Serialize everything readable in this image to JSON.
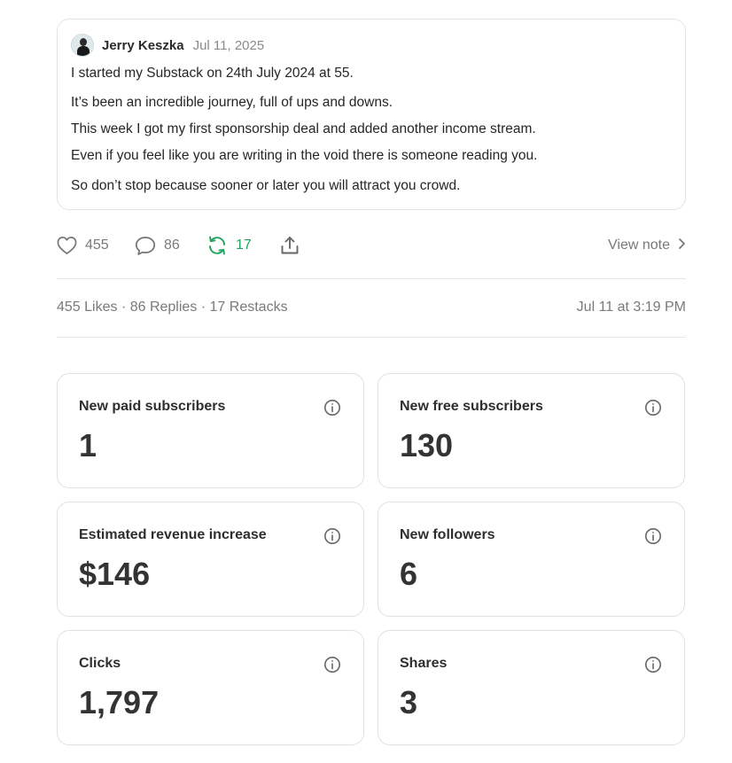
{
  "note": {
    "author": "Jerry Keszka",
    "date": "Jul 11, 2025",
    "lines": [
      "I started my Substack on 24th July 2024 at 55.",
      "It’s been an incredible journey, full of ups and downs.",
      "This week I got my first sponsorship deal and added another income stream.",
      "Even if you feel like you are writing in the void there is someone reading you.",
      "So don’t stop because sooner or later you will attract you crowd."
    ]
  },
  "actions": {
    "likes": "455",
    "replies": "86",
    "restacks": "17",
    "view_note": "View note",
    "restack_color": "#22a35e"
  },
  "stats": {
    "summary": "455 Likes · 86 Replies · 17 Restacks",
    "timestamp": "Jul 11 at 3:19 PM"
  },
  "metrics": [
    {
      "label": "New paid subscribers",
      "value": "1"
    },
    {
      "label": "New free subscribers",
      "value": "130"
    },
    {
      "label": "Estimated revenue increase",
      "value": "$146"
    },
    {
      "label": "New followers",
      "value": "6"
    },
    {
      "label": "Clicks",
      "value": "1,797"
    },
    {
      "label": "Shares",
      "value": "3"
    }
  ],
  "icons": {
    "like": "heart-icon",
    "reply": "comment-icon",
    "restack": "restack-icon",
    "share": "share-icon",
    "view": "chevron-right-icon",
    "info": "info-icon"
  }
}
